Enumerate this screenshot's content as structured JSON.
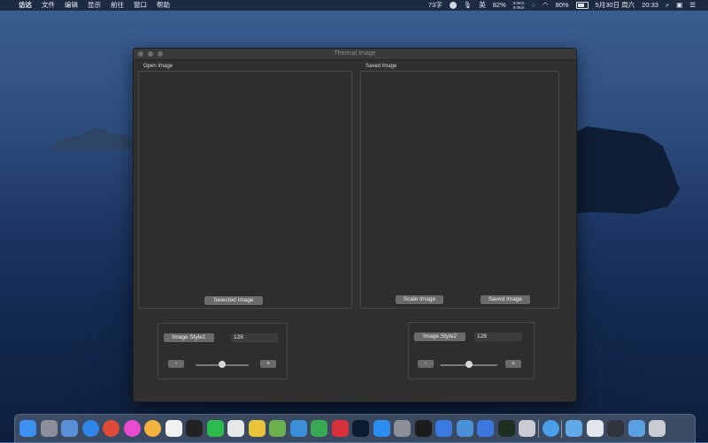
{
  "menubar": {
    "app_name": "访达",
    "items": [
      "文件",
      "编辑",
      "显示",
      "前往",
      "窗口",
      "帮助"
    ],
    "cpu_text": "73字",
    "input_method": "英",
    "brightness": "82%",
    "net_up": "0.0K/s",
    "net_down": "0.0K/s",
    "battery": "80%",
    "date": "5月30日 周六",
    "time": "20:33"
  },
  "window": {
    "title": "Thermal Image",
    "open_label": "Open Image",
    "saved_label": "Saved Image",
    "selected_button": "Selected Image",
    "scale_button": "Scale Image",
    "saved_button": "Saved Image",
    "style1": {
      "button": "Image Style1",
      "value": "128",
      "minus": "-",
      "plus": "+",
      "slider_fraction": 0.5
    },
    "style2": {
      "button": "Image Style2",
      "value": "128",
      "minus": "-",
      "plus": "+",
      "slider_fraction": 0.5
    }
  },
  "dock": {
    "icons": [
      {
        "name": "finder-icon",
        "color": "#3d8ff0"
      },
      {
        "name": "launchpad-icon",
        "color": "#8a8f99"
      },
      {
        "name": "preview-icon",
        "color": "#5b8fd6"
      },
      {
        "name": "safari-icon",
        "color": "#2f86e8"
      },
      {
        "name": "chrome-icon",
        "color": "#e04a3b"
      },
      {
        "name": "color-picker-icon",
        "color": "#e64bd0"
      },
      {
        "name": "photos-icon",
        "color": "#f3b33d"
      },
      {
        "name": "calendar-icon",
        "color": "#f2f2f2"
      },
      {
        "name": "qq-icon",
        "color": "#222222"
      },
      {
        "name": "wechat-icon",
        "color": "#2dbb4e"
      },
      {
        "name": "chat-icon",
        "color": "#e8e8e8"
      },
      {
        "name": "sketch-icon",
        "color": "#e7c43a"
      },
      {
        "name": "android-studio-icon",
        "color": "#6ab04c"
      },
      {
        "name": "xcode-icon",
        "color": "#3b8fd9"
      },
      {
        "name": "numbers-icon",
        "color": "#38a852"
      },
      {
        "name": "youdao-icon",
        "color": "#d6303b"
      },
      {
        "name": "photoshop-icon",
        "color": "#0d1b2e"
      },
      {
        "name": "app-store-icon",
        "color": "#2b8ef0"
      },
      {
        "name": "system-preferences-icon",
        "color": "#8b8f96"
      },
      {
        "name": "terminal-icon",
        "color": "#1c1c1c"
      },
      {
        "name": "network-utility-icon",
        "color": "#3a7be0"
      },
      {
        "name": "settings-icon",
        "color": "#4a90d9"
      },
      {
        "name": "vpn-icon",
        "color": "#3b77dc"
      },
      {
        "name": "activity-monitor-icon",
        "color": "#1f2f22"
      },
      {
        "name": "image-capture-icon",
        "color": "#c9ccd3"
      },
      {
        "name": "thermal-image-app-icon",
        "color": "#4aa0e8"
      },
      {
        "name": "folder-icon",
        "color": "#62a9e8"
      },
      {
        "name": "document-icon",
        "color": "#e3e6ea"
      },
      {
        "name": "screenshot-stack-icon",
        "color": "#30353d"
      },
      {
        "name": "downloads-folder-icon",
        "color": "#5a9fe0"
      },
      {
        "name": "trash-icon",
        "color": "#c8ccd2"
      }
    ]
  }
}
